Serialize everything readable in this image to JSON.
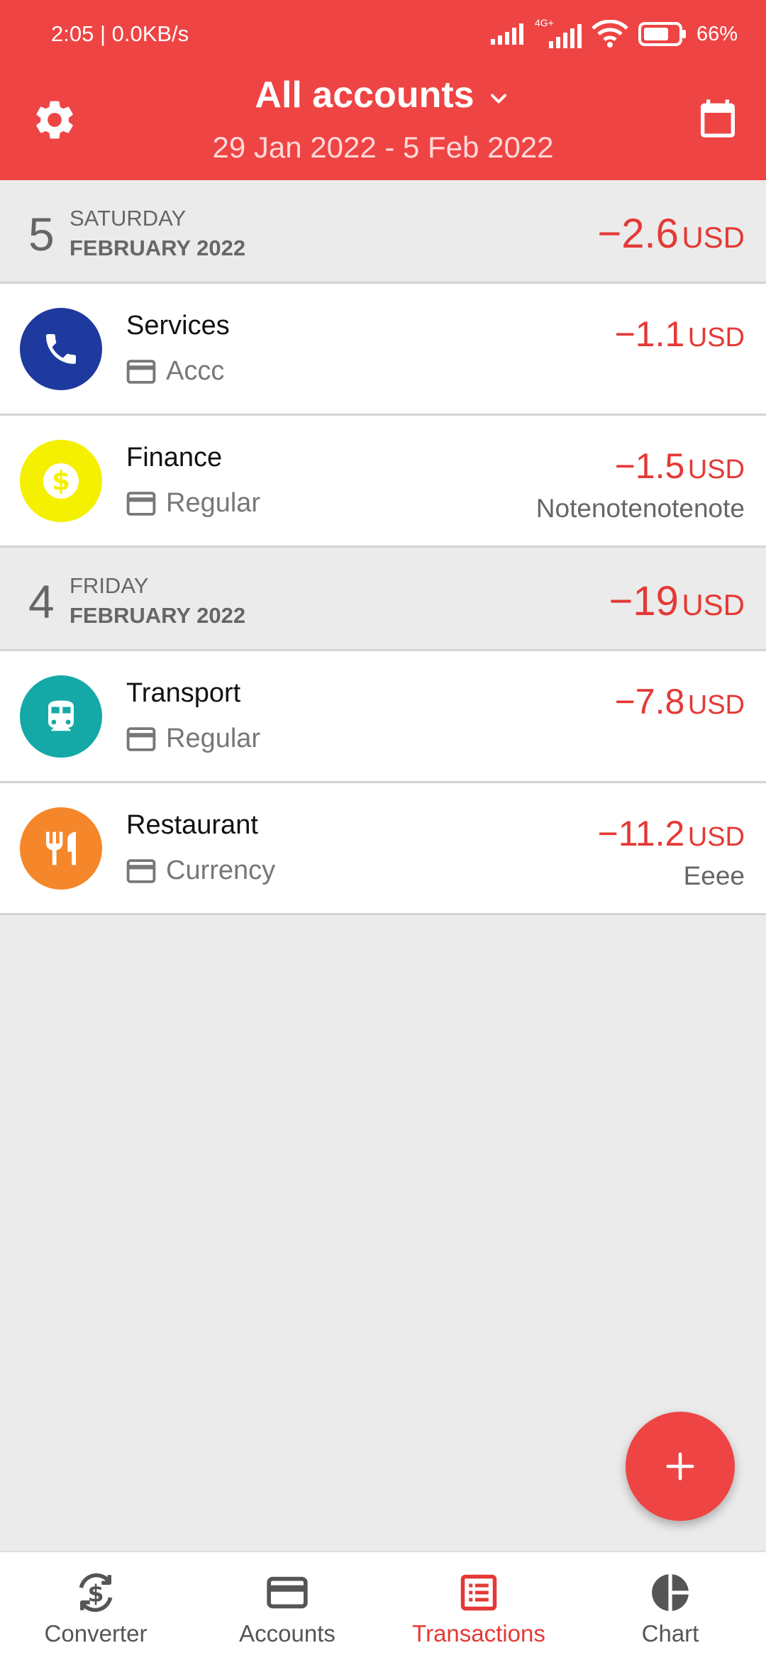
{
  "status_bar": {
    "time_speed": "2:05 | 0.0KB/s",
    "network": "4G+",
    "battery": "66%"
  },
  "header": {
    "title": "All accounts",
    "date_range": "29 Jan 2022 - 5 Feb 2022"
  },
  "days": [
    {
      "day_num": "5",
      "day_name": "SATURDAY",
      "month": "FEBRUARY 2022",
      "total": "−2.6",
      "currency": "USD",
      "transactions": [
        {
          "category": "Services",
          "account": "Accc",
          "amount": "−1.1",
          "currency": "USD",
          "note": "",
          "icon": "phone-icon",
          "color": "#1e3a9e"
        },
        {
          "category": "Finance",
          "account": "Regular",
          "amount": "−1.5",
          "currency": "USD",
          "note": "Notenotenotenote",
          "icon": "dollar-icon",
          "color": "#f5f000"
        }
      ]
    },
    {
      "day_num": "4",
      "day_name": "FRIDAY",
      "month": "FEBRUARY 2022",
      "total": "−19",
      "currency": "USD",
      "transactions": [
        {
          "category": "Transport",
          "account": "Regular",
          "amount": "−7.8",
          "currency": "USD",
          "note": "",
          "icon": "train-icon",
          "color": "#14a9a7"
        },
        {
          "category": "Restaurant",
          "account": "Currency",
          "amount": "−11.2",
          "currency": "USD",
          "note": "Eeee",
          "icon": "fork-knife-icon",
          "color": "#f5862a"
        }
      ]
    }
  ],
  "bottom_nav": [
    {
      "label": "Converter",
      "icon": "currency-exchange-icon",
      "active": false
    },
    {
      "label": "Accounts",
      "icon": "card-icon",
      "active": false
    },
    {
      "label": "Transactions",
      "icon": "list-icon",
      "active": true
    },
    {
      "label": "Chart",
      "icon": "pie-chart-icon",
      "active": false
    }
  ],
  "colors": {
    "primary": "#ef4444",
    "expense": "#e53935",
    "background": "#ebebeb"
  }
}
